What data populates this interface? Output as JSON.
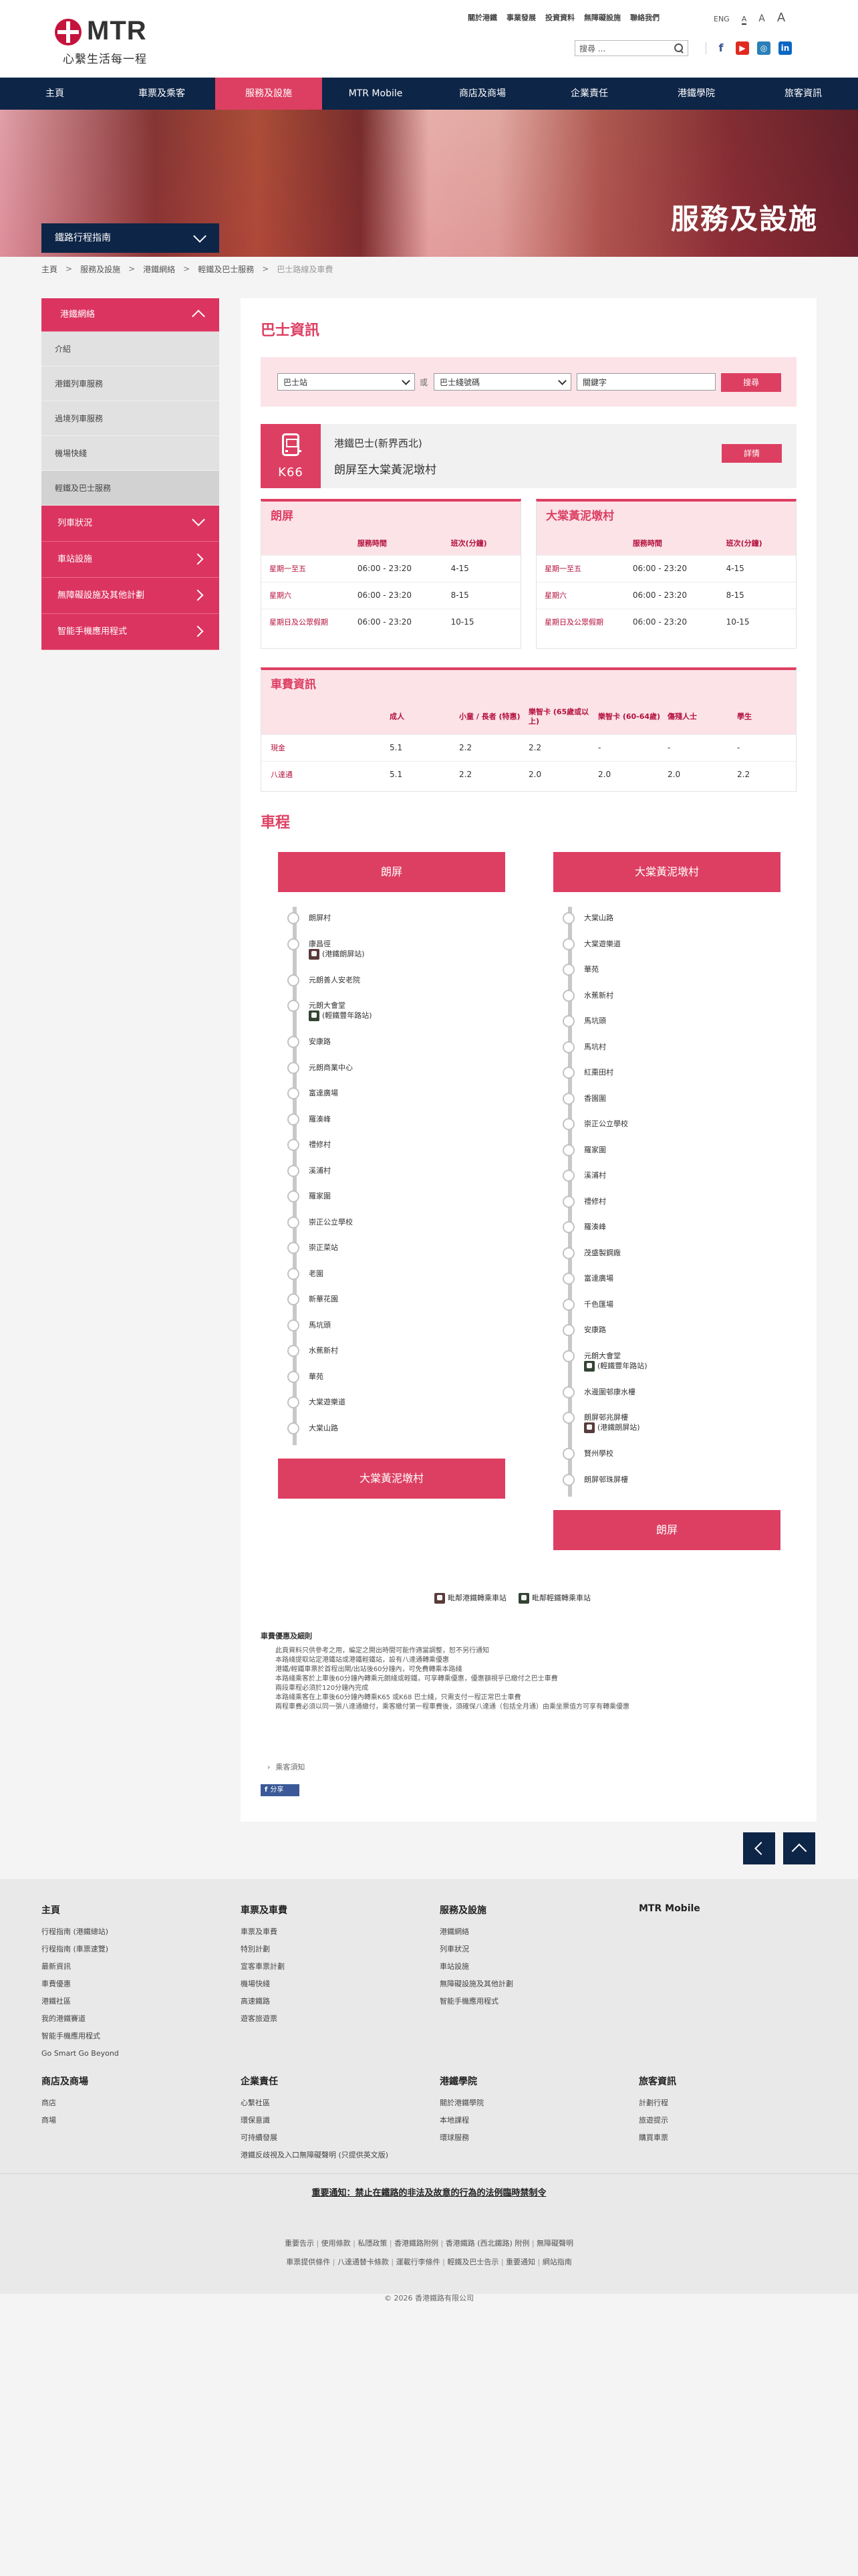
{
  "header": {
    "logo_text": "MTR",
    "slogan": "心繫生活每一程",
    "top_links": [
      "關於港鐵",
      "事業發展",
      "投資資料",
      "無障礙設施",
      "聯絡我們"
    ],
    "lang": "ENG",
    "font_sizes": [
      "A",
      "A",
      "A"
    ],
    "search_placeholder": "搜尋 ...",
    "social": [
      "f",
      "▶",
      "◎",
      "in"
    ]
  },
  "nav": [
    "主頁",
    "車票及乘客",
    "服務及設施",
    "MTR Mobile",
    "商店及商場",
    "企業責任",
    "港鐵學院",
    "旅客資訊"
  ],
  "banner": {
    "title": "服務及設施",
    "guide": "鐵路行程指南"
  },
  "breadcrumb": [
    "主頁",
    "服務及設施",
    "港鐵網絡",
    "輕鐵及巴士服務",
    "巴士路線及車費"
  ],
  "sidebar": {
    "network": "港鐵網絡",
    "subs": [
      "介紹",
      "港鐵列車服務",
      "過境列車服務",
      "機場快綫",
      "輕鐵及巴士服務"
    ],
    "others": [
      "列車狀況",
      "車站設施",
      "無障礙設施及其他計劃",
      "智能手機應用程式"
    ]
  },
  "main": {
    "title": "巴士資訊",
    "search": {
      "station": "巴士站",
      "or": "或",
      "route": "巴士綫號碼",
      "keyword": "關鍵字",
      "button": "搜尋"
    },
    "route": {
      "number": "K66",
      "operator": "港鐵巴士(新界西北)",
      "name": "朗屏至大棠黃泥墩村",
      "detail": "詳情"
    },
    "timetables": [
      {
        "title": "朗屏",
        "headers": [
          "",
          "服務時間",
          "班次(分鐘)"
        ],
        "rows": [
          [
            "星期一至五",
            "06:00 - 23:20",
            "4-15"
          ],
          [
            "星期六",
            "06:00 - 23:20",
            "8-15"
          ],
          [
            "星期日及公眾假期",
            "06:00 - 23:20",
            "10-15"
          ]
        ]
      },
      {
        "title": "大棠黃泥墩村",
        "headers": [
          "",
          "服務時間",
          "班次(分鐘)"
        ],
        "rows": [
          [
            "星期一至五",
            "06:00 - 23:20",
            "4-15"
          ],
          [
            "星期六",
            "06:00 - 23:20",
            "8-15"
          ],
          [
            "星期日及公眾假期",
            "06:00 - 23:20",
            "10-15"
          ]
        ]
      }
    ],
    "fare": {
      "title": "車費資訊",
      "headers": [
        "",
        "成人",
        "小童 / 長者 (特惠)",
        "樂智卡 (65歲或以上)",
        "樂智卡 (60-64歲)",
        "傷殘人士",
        "學生"
      ],
      "rows": [
        [
          "現金",
          "5.1",
          "2.2",
          "2.2",
          "-",
          "-",
          "-"
        ],
        [
          "八達通",
          "5.1",
          "2.2",
          "2.0",
          "2.0",
          "2.0",
          "2.2"
        ]
      ]
    },
    "journey_title": "車程",
    "journey": [
      {
        "from": "朗屏",
        "to": "大棠黃泥墩村",
        "stops": [
          {
            "name": "朗屏村"
          },
          {
            "name": "康昌徑",
            "xfer": "(港鐵朗屏站)",
            "type": "mtr"
          },
          {
            "name": "元朗善人安老院"
          },
          {
            "name": "元朗大會堂",
            "xfer": "(輕鐵豐年路站)",
            "type": "lr"
          },
          {
            "name": "安康路"
          },
          {
            "name": "元朗商業中心"
          },
          {
            "name": "富達廣場"
          },
          {
            "name": "羅湊峰"
          },
          {
            "name": "禮修村"
          },
          {
            "name": "溪浦村"
          },
          {
            "name": "羅家圍"
          },
          {
            "name": "崇正公立學校"
          },
          {
            "name": "崇正菜站"
          },
          {
            "name": "老圍"
          },
          {
            "name": "新華花園"
          },
          {
            "name": "馬坑頭"
          },
          {
            "name": "水蕉新村"
          },
          {
            "name": "華苑"
          },
          {
            "name": "大棠遊樂道"
          },
          {
            "name": "大棠山路"
          }
        ]
      },
      {
        "from": "大棠黃泥墩村",
        "to": "朗屏",
        "stops": [
          {
            "name": "大棠山路"
          },
          {
            "name": "大棠遊樂道"
          },
          {
            "name": "華苑"
          },
          {
            "name": "水蕉新村"
          },
          {
            "name": "馬坑頭"
          },
          {
            "name": "馬坑村"
          },
          {
            "name": "紅棗田村"
          },
          {
            "name": "香園圍"
          },
          {
            "name": "崇正公立學校"
          },
          {
            "name": "羅家圍"
          },
          {
            "name": "溪浦村"
          },
          {
            "name": "禮修村"
          },
          {
            "name": "羅湊峰"
          },
          {
            "name": "茂盛製鋼廠"
          },
          {
            "name": "富達廣場"
          },
          {
            "name": "千色匯場"
          },
          {
            "name": "安康路"
          },
          {
            "name": "元朗大會堂",
            "xfer": "(輕鐵豐年路站)",
            "type": "lr"
          },
          {
            "name": "水邊圍邨康水樓"
          },
          {
            "name": "朗屏邨兆屏樓",
            "xfer": "(港鐵朗屏站)",
            "type": "mtr"
          },
          {
            "name": "賢州學校"
          },
          {
            "name": "朗屏邨珠屏樓"
          }
        ]
      }
    ],
    "legend": {
      "mtr": "毗鄰港鐵轉乘車站",
      "lr": "毗鄰輕鐵轉乘車站"
    },
    "notes_title": "車費優惠及細則",
    "notes": [
      "此頁資料只供參考之用，編定之開出時間可能作適當調整，恕不另行通知",
      "本路綫提取站定港鐵站或港鐵輕鐵站，設有八達通轉乘優惠",
      "港鐵/輕鐵車票於首程出閘/出站後60分鐘內，可免費轉乘本路綫",
      "本路綫乘客於上車後60分鐘內轉乘元朗綫或輕鐵，可享轉乘優惠，優惠額視乎已繳付之巴士車費",
      "兩段車程必須於120分鐘內完成",
      "本路綫乘客在上車後60分鐘內轉乘K65 或K68 巴士綫，只需支付一程正常巴士車費",
      "兩程車費必須以同一張八達通繳付，乘客繳付第一程車費後，須確保八達通（包括全月通）由乘坐票值方可享有轉乘優惠"
    ],
    "bus_notice": "乘客須知",
    "share": {
      "icon": "f",
      "label": "分享"
    }
  },
  "footer": {
    "cols": [
      {
        "title": "主頁",
        "items": [
          "行程指南 (港鐵總站)",
          "行程指南 (車票速覽)",
          "最新資訊",
          "車費優惠",
          "港鐵社區",
          "我的港鐵賽道",
          "智能手機應用程式",
          "Go Smart Go Beyond"
        ]
      },
      {
        "title": "車票及車費",
        "items": [
          "車票及車費",
          "特別計劃",
          "宣客車票計劃",
          "機場快綫",
          "高速鐵路",
          "遊客旅遊票"
        ]
      },
      {
        "title": "服務及設施",
        "items": [
          "港鐵網絡",
          "列車狀況",
          "車站設施",
          "無障礙設施及其他計劃",
          "智能手機應用程式"
        ]
      },
      {
        "title": "MTR Mobile",
        "items": []
      },
      {
        "title": "商店及商場",
        "items": [
          "商店",
          "商場"
        ]
      },
      {
        "title": "企業責任",
        "items": [
          "心繫社區",
          "環保意識",
          "可持續發展",
          "港鐵反歧視及入口無障礙聲明 (只提供英文版)"
        ]
      },
      {
        "title": "港鐵學院",
        "items": [
          "關於港鐵學院",
          "本地課程",
          "環球服務"
        ]
      },
      {
        "title": "旅客資訊",
        "items": [
          "計劃行程",
          "旅遊提示",
          "購買車票"
        ]
      }
    ],
    "alert": "重要通知：禁止在鐵路的非法及故意的行為的法例臨時禁制令",
    "links1": [
      "重要告示",
      "使用條款",
      "私隱政策",
      "香港鐵路附例",
      "香港鐵路 (西北鐵路) 附例",
      "無障礙聲明"
    ],
    "links2": [
      "車票提供條件",
      "八達通替卡條款",
      "運載行李條件",
      "輕鐵及巴士告示",
      "重要通知",
      "網站指南"
    ],
    "copyright": "© 2026 香港鐵路有限公司"
  },
  "colors": {
    "brand": "#dd3f62",
    "navy": "#0d2547",
    "mtr_red": "#c4143c"
  }
}
